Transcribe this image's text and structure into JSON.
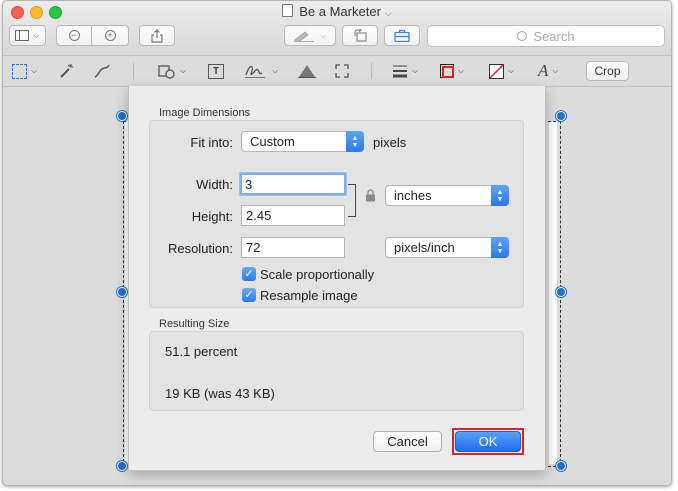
{
  "window": {
    "title": "Be a Marketer"
  },
  "toolbar": {
    "search_placeholder": "Search"
  },
  "markup": {
    "crop_label": "Crop",
    "accent_color": "#d8232a"
  },
  "dialog": {
    "image_dimensions_label": "Image Dimensions",
    "fit_into_label": "Fit into:",
    "fit_into_value": "Custom",
    "fit_into_unit": "pixels",
    "width_label": "Width:",
    "width_value": "3",
    "height_label": "Height:",
    "height_value": "2.45",
    "size_unit": "inches",
    "resolution_label": "Resolution:",
    "resolution_value": "72",
    "resolution_unit": "pixels/inch",
    "scale_label": "Scale proportionally",
    "scale_checked": true,
    "resample_label": "Resample image",
    "resample_checked": true,
    "resulting_size_label": "Resulting Size",
    "percent_text": "51.1 percent",
    "size_text": "19 KB (was 43 KB)",
    "cancel_label": "Cancel",
    "ok_label": "OK"
  }
}
